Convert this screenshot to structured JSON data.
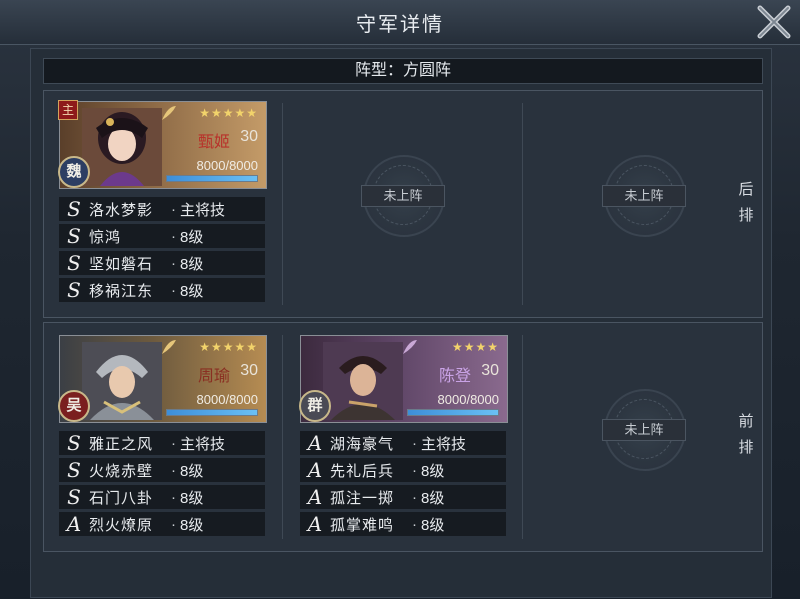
{
  "header": {
    "title": "守军详情"
  },
  "formation": {
    "label": "阵型：方圆阵"
  },
  "rows": {
    "back_label": "后排",
    "front_label": "前排"
  },
  "empty_slot_label": "未上阵",
  "generals": [
    {
      "name": "甄姬",
      "level": "30",
      "stars": "★★★★★",
      "star_count": 5,
      "hp_text": "8000/8000",
      "hp_fraction": 1.0,
      "faction": "魏",
      "lord_tag": "主",
      "skills": [
        {
          "grade": "S",
          "name": "洛水梦影",
          "tail": "主将技"
        },
        {
          "grade": "S",
          "name": "惊鸿",
          "tail": "8级"
        },
        {
          "grade": "S",
          "name": "坚如磐石",
          "tail": "8级"
        },
        {
          "grade": "S",
          "name": "移祸江东",
          "tail": "8级"
        }
      ]
    },
    {
      "name": "周瑜",
      "level": "30",
      "stars": "★★★★★",
      "star_count": 5,
      "hp_text": "8000/8000",
      "hp_fraction": 1.0,
      "faction": "吴",
      "skills": [
        {
          "grade": "S",
          "name": "雅正之风",
          "tail": "主将技"
        },
        {
          "grade": "S",
          "name": "火烧赤壁",
          "tail": "8级"
        },
        {
          "grade": "S",
          "name": "石门八卦",
          "tail": "8级"
        },
        {
          "grade": "A",
          "name": "烈火燎原",
          "tail": "8级"
        }
      ]
    },
    {
      "name": "陈登",
      "level": "30",
      "stars": "★★★★",
      "star_count": 4,
      "hp_text": "8000/8000",
      "hp_fraction": 1.0,
      "faction": "群",
      "skills": [
        {
          "grade": "A",
          "name": "湖海豪气",
          "tail": "主将技"
        },
        {
          "grade": "A",
          "name": "先礼后兵",
          "tail": "8级"
        },
        {
          "grade": "A",
          "name": "孤注一掷",
          "tail": "8级"
        },
        {
          "grade": "A",
          "name": "孤掌难鸣",
          "tail": "8级"
        }
      ]
    }
  ],
  "colors": {
    "accent_gold": "#f2d36b",
    "hp_blue": "#3d8ed8",
    "lord_red": "#8e1a1a"
  }
}
